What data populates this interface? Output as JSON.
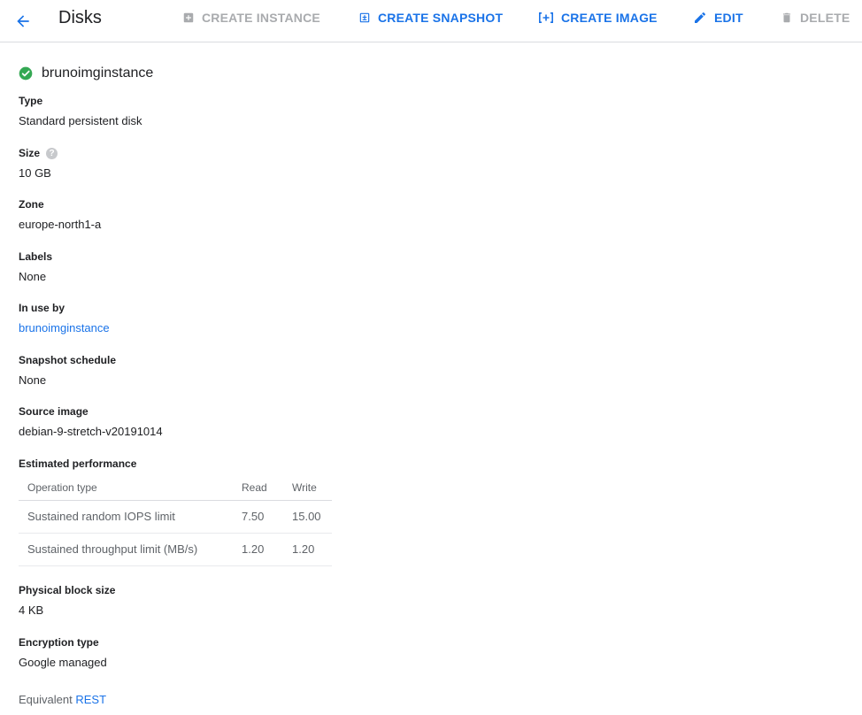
{
  "toolbar": {
    "title": "Disks",
    "actions": {
      "create_instance": "CREATE INSTANCE",
      "create_snapshot": "CREATE SNAPSHOT",
      "create_image": "CREATE IMAGE",
      "edit": "EDIT",
      "delete": "DELETE"
    }
  },
  "disk": {
    "name": "brunoimginstance",
    "status": "ok"
  },
  "fields": {
    "type_label": "Type",
    "type_value": "Standard persistent disk",
    "size_label": "Size",
    "size_value": "10 GB",
    "zone_label": "Zone",
    "zone_value": "europe-north1-a",
    "labels_label": "Labels",
    "labels_value": "None",
    "in_use_by_label": "In use by",
    "in_use_by_value": "brunoimginstance",
    "snapshot_schedule_label": "Snapshot schedule",
    "snapshot_schedule_value": "None",
    "source_image_label": "Source image",
    "source_image_value": "debian-9-stretch-v20191014",
    "estimated_performance_label": "Estimated performance",
    "physical_block_size_label": "Physical block size",
    "physical_block_size_value": "4 KB",
    "encryption_type_label": "Encryption type",
    "encryption_type_value": "Google managed"
  },
  "performance": {
    "headers": [
      "Operation type",
      "Read",
      "Write"
    ],
    "rows": [
      {
        "operation": "Sustained random IOPS limit",
        "read": "7.50",
        "write": "15.00"
      },
      {
        "operation": "Sustained throughput limit (MB/s)",
        "read": "1.20",
        "write": "1.20"
      }
    ]
  },
  "footer": {
    "equivalent": "Equivalent",
    "rest": "REST"
  },
  "colors": {
    "accent": "#1a73e8",
    "disabled": "#a9abae",
    "success": "#34a853"
  }
}
